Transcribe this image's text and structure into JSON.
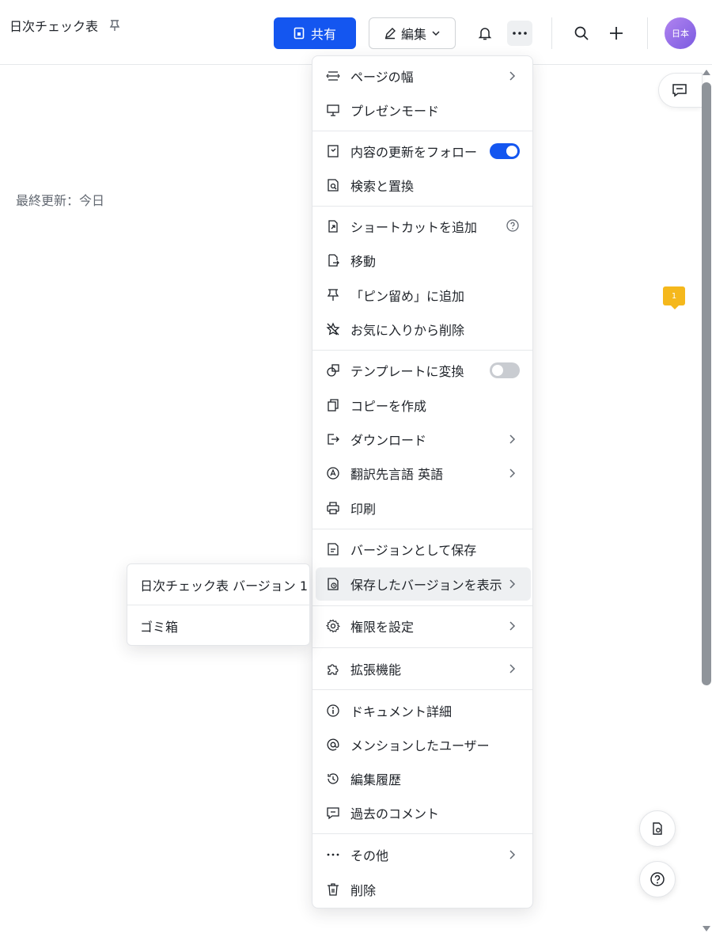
{
  "header": {
    "doc_title": "日次チェック表",
    "share_label": "共有",
    "edit_label": "編集",
    "avatar_text": "日本"
  },
  "page": {
    "last_updated": "最終更新：今日",
    "comment_badge": "1"
  },
  "menu": {
    "items": [
      {
        "label": "ページの幅",
        "icon": "page-width-icon",
        "suffix": "chevron"
      },
      {
        "label": "プレゼンモード",
        "icon": "presentation-icon"
      },
      {
        "label": "内容の更新をフォロー",
        "icon": "follow-icon",
        "suffix": "toggle-on"
      },
      {
        "label": "検索と置換",
        "icon": "find-replace-icon"
      },
      {
        "label": "ショートカットを追加",
        "icon": "shortcut-icon",
        "suffix": "help"
      },
      {
        "label": "移動",
        "icon": "move-icon"
      },
      {
        "label": "「ピン留め」に追加",
        "icon": "pin-icon"
      },
      {
        "label": "お気に入りから削除",
        "icon": "unstar-icon"
      },
      {
        "label": "テンプレートに変換",
        "icon": "template-icon",
        "suffix": "toggle-off"
      },
      {
        "label": "コピーを作成",
        "icon": "copy-icon"
      },
      {
        "label": "ダウンロード",
        "icon": "download-icon",
        "suffix": "chevron"
      },
      {
        "label": "翻訳先言語 英語",
        "icon": "translate-icon",
        "suffix": "chevron"
      },
      {
        "label": "印刷",
        "icon": "print-icon"
      },
      {
        "label": "バージョンとして保存",
        "icon": "save-version-icon"
      },
      {
        "label": "保存したバージョンを表示",
        "icon": "versions-icon",
        "suffix": "chevron"
      },
      {
        "label": "権限を設定",
        "icon": "settings-icon",
        "suffix": "chevron"
      },
      {
        "label": "拡張機能",
        "icon": "extension-icon",
        "suffix": "chevron"
      },
      {
        "label": "ドキュメント詳細",
        "icon": "info-icon"
      },
      {
        "label": "メンションしたユーザー",
        "icon": "mention-icon"
      },
      {
        "label": "編集履歴",
        "icon": "history-icon"
      },
      {
        "label": "過去のコメント",
        "icon": "comment-history-icon"
      },
      {
        "label": "その他",
        "icon": "more-icon",
        "suffix": "chevron"
      },
      {
        "label": "削除",
        "icon": "trash-icon"
      }
    ]
  },
  "submenu": {
    "items": [
      {
        "label": "日次チェック表 バージョン 1"
      },
      {
        "label": "ゴミ箱"
      }
    ]
  }
}
